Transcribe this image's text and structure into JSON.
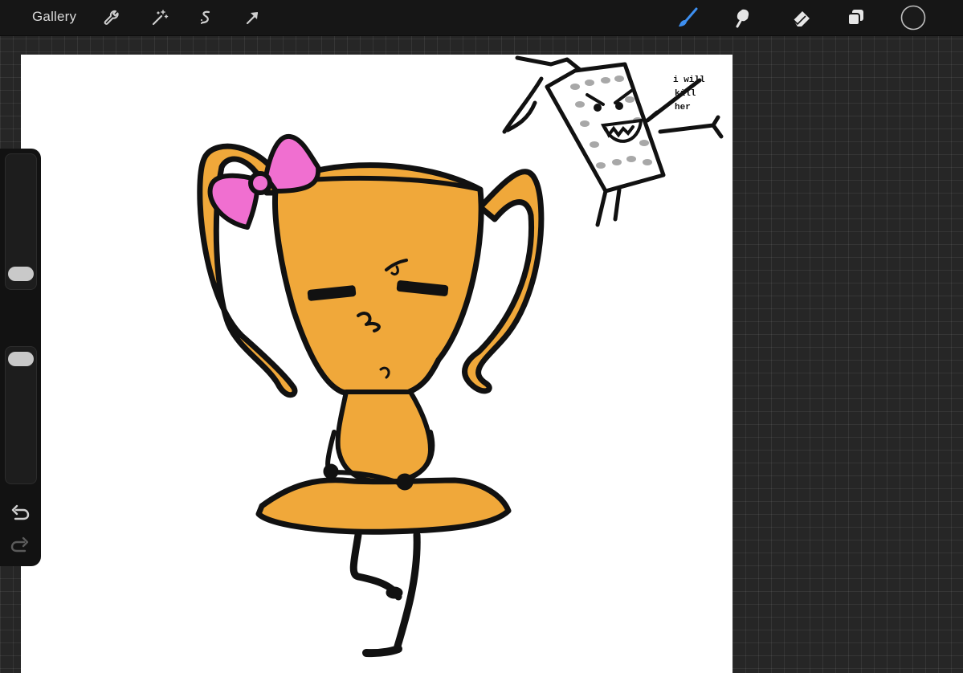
{
  "topbar": {
    "gallery_label": "Gallery",
    "left_tools": [
      "wrench-icon",
      "magic-wand-icon",
      "selection-icon",
      "transform-arrow-icon"
    ],
    "right_tools": [
      "brush-icon",
      "smudge-icon",
      "eraser-icon",
      "layers-icon",
      "color-swatch"
    ],
    "active_tool": "brush",
    "accent_color": "#3d8ff0",
    "current_color": "#1a1a1a"
  },
  "sidebar": {
    "brush_size": 0.55,
    "brush_opacity": 0.95,
    "controls": [
      "brush-size-slider",
      "modify-button",
      "opacity-slider",
      "undo-button",
      "redo-button"
    ]
  },
  "canvas": {
    "background": "#ffffff",
    "trophy_color": "#f0a83a",
    "bow_color": "#f06fd0",
    "doodle_text": [
      "i will",
      "kill",
      "her"
    ]
  }
}
